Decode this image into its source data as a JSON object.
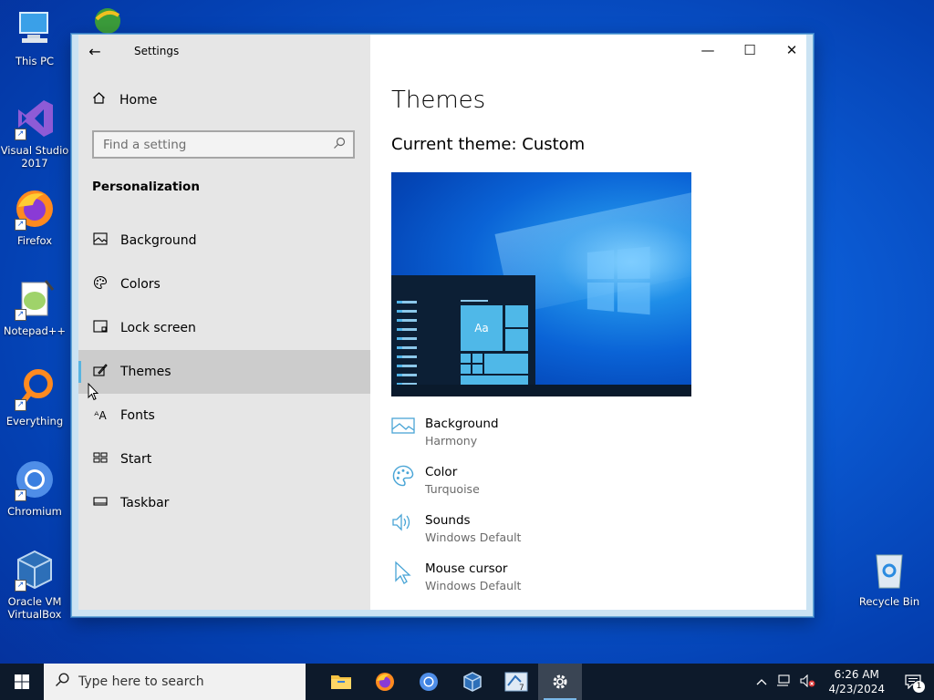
{
  "desktop": {
    "icons": [
      {
        "label": "This PC",
        "icon": "computer-icon"
      },
      {
        "label": "Visual Studio 2017",
        "icon": "visual-studio-icon"
      },
      {
        "label": "Firefox",
        "icon": "firefox-icon"
      },
      {
        "label": "Notepad++",
        "icon": "notepadpp-icon"
      },
      {
        "label": "Everything",
        "icon": "search-magnifier-icon"
      },
      {
        "label": "Chromium",
        "icon": "chromium-icon"
      },
      {
        "label": "Oracle VM VirtualBox",
        "icon": "virtualbox-icon"
      },
      {
        "label": "Recycle Bin",
        "icon": "recycle-bin-icon"
      }
    ]
  },
  "window": {
    "title": "Settings",
    "home_label": "Home",
    "search_placeholder": "Find a setting",
    "section_title": "Personalization",
    "nav": [
      {
        "label": "Background",
        "icon": "picture-icon"
      },
      {
        "label": "Colors",
        "icon": "palette-icon"
      },
      {
        "label": "Lock screen",
        "icon": "lock-screen-icon"
      },
      {
        "label": "Themes",
        "icon": "brush-icon",
        "active": true
      },
      {
        "label": "Fonts",
        "icon": "fonts-icon"
      },
      {
        "label": "Start",
        "icon": "start-tiles-icon"
      },
      {
        "label": "Taskbar",
        "icon": "taskbar-icon"
      }
    ],
    "page_title": "Themes",
    "current_theme": "Current theme: Custom",
    "preview_tile_text": "Aa",
    "theme_items": [
      {
        "label": "Background",
        "value": "Harmony",
        "icon": "picture-icon"
      },
      {
        "label": "Color",
        "value": "Turquoise",
        "icon": "palette-icon"
      },
      {
        "label": "Sounds",
        "value": "Windows Default",
        "icon": "speaker-icon"
      },
      {
        "label": "Mouse cursor",
        "value": "Windows Default",
        "icon": "cursor-icon"
      }
    ]
  },
  "taskbar": {
    "search_placeholder": "Type here to search",
    "time": "6:26 AM",
    "date": "4/23/2024",
    "notification_count": "1"
  },
  "colors": {
    "accent": "#58b4e0",
    "taskbar": "#0d1a2b"
  }
}
